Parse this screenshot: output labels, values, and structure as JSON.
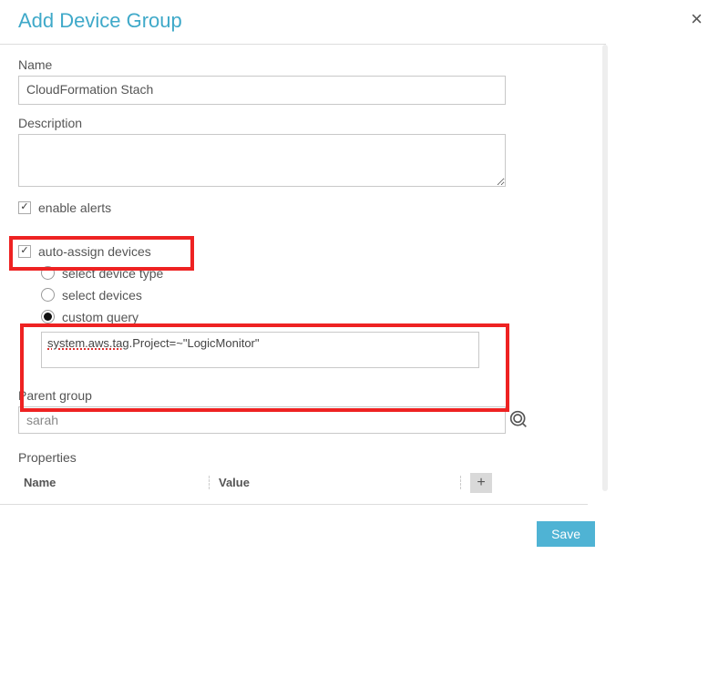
{
  "modal": {
    "title": "Add Device Group",
    "close_glyph": "×"
  },
  "name": {
    "label": "Name",
    "value": "CloudFormation Stach"
  },
  "description": {
    "label": "Description",
    "value": ""
  },
  "enable_alerts": {
    "label": "enable alerts",
    "checked": true
  },
  "auto_assign": {
    "label": "auto-assign devices",
    "checked": true
  },
  "radios": {
    "select_device_type": "select device type",
    "select_devices": "select devices",
    "custom_query": "custom query"
  },
  "query_parts": {
    "spell1": "system.aws.tag",
    "rest": ".Project=~\"LogicMonitor\""
  },
  "parent": {
    "label": "Parent group",
    "value": "sarah"
  },
  "properties": {
    "heading": "Properties",
    "name_col": "Name",
    "value_col": "Value",
    "add_glyph": "+"
  },
  "footer": {
    "save": "Save"
  },
  "check_glyph": "✓"
}
